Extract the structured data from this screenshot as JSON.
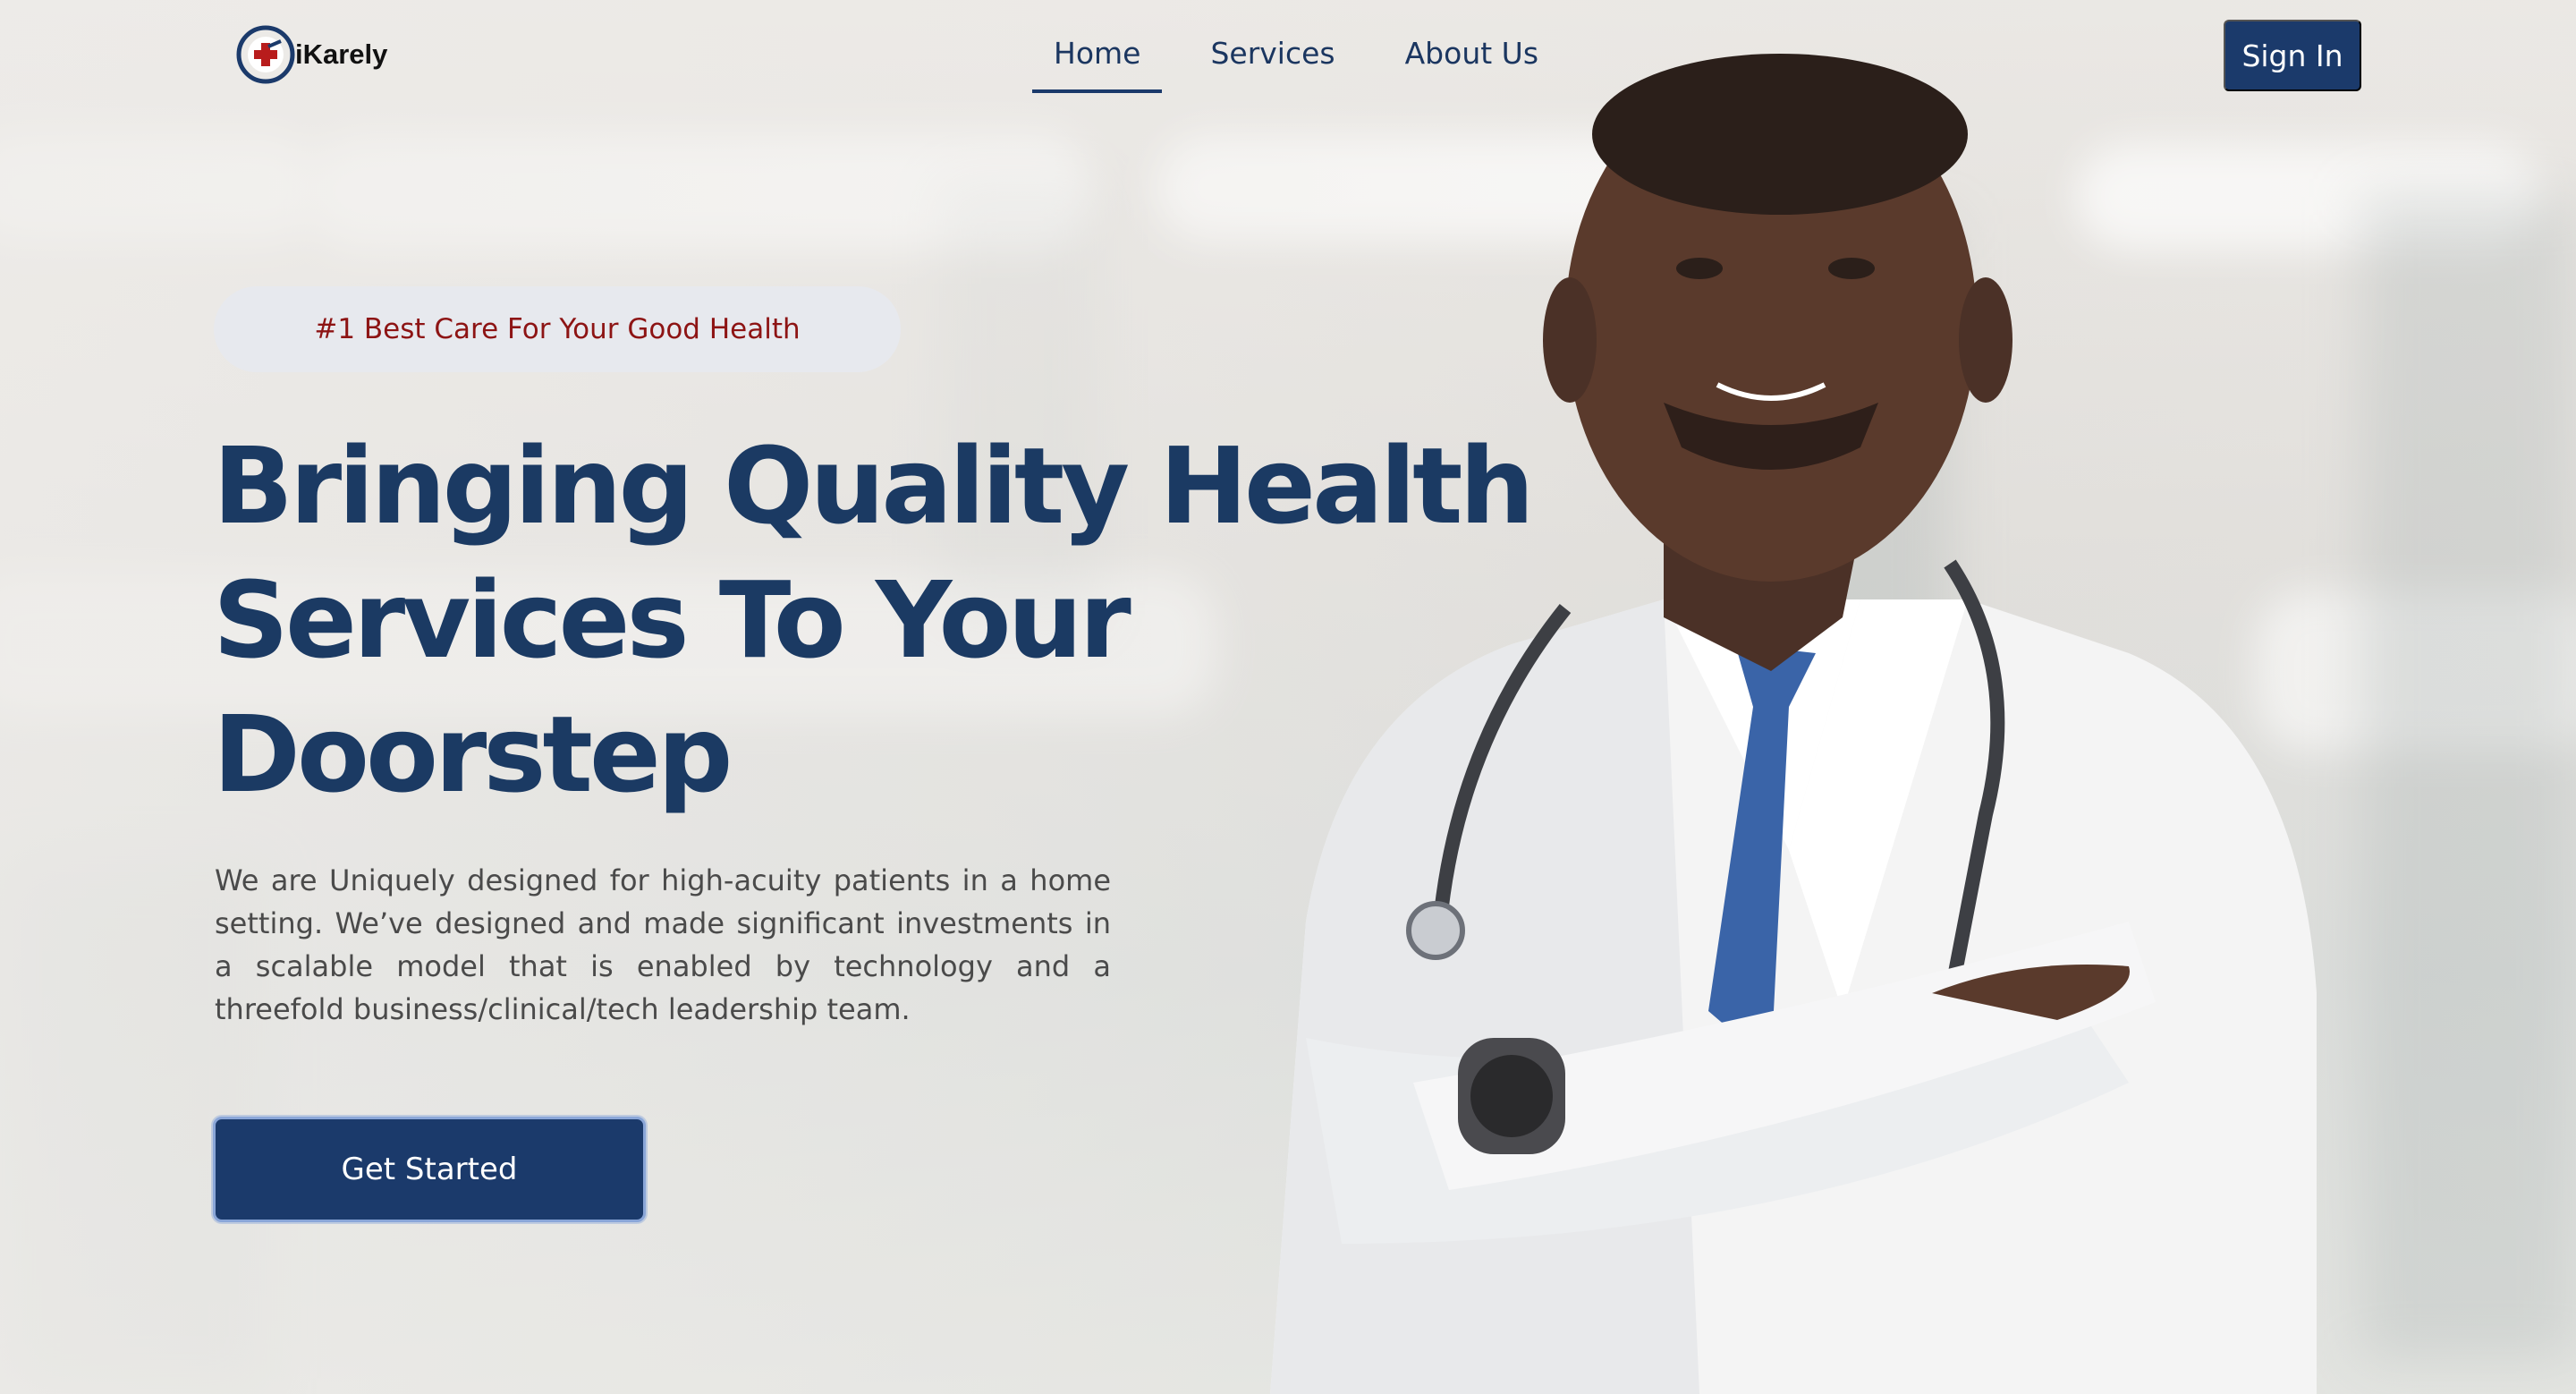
{
  "brand": {
    "name": "iKarely",
    "colors": {
      "primary": "#1b3a6b",
      "accent": "#8d1414"
    }
  },
  "nav": {
    "items": [
      {
        "label": "Home",
        "active": true
      },
      {
        "label": "Services",
        "active": false
      },
      {
        "label": "About Us",
        "active": false
      }
    ],
    "signin_label": "Sign In"
  },
  "hero": {
    "badge": "#1 Best Care For Your Good Health",
    "headline_lines": [
      "Bringing Quality Health",
      "Services To Your",
      "Doorstep"
    ],
    "description": "We are Uniquely designed for high-acuity patients in a home setting. We’ve designed and made significant investments in a scalable model that is enabled by technology and a threefold business/clinical/tech leadership team.",
    "cta_label": "Get Started"
  },
  "image": {
    "subject": "doctor-with-stethoscope"
  }
}
